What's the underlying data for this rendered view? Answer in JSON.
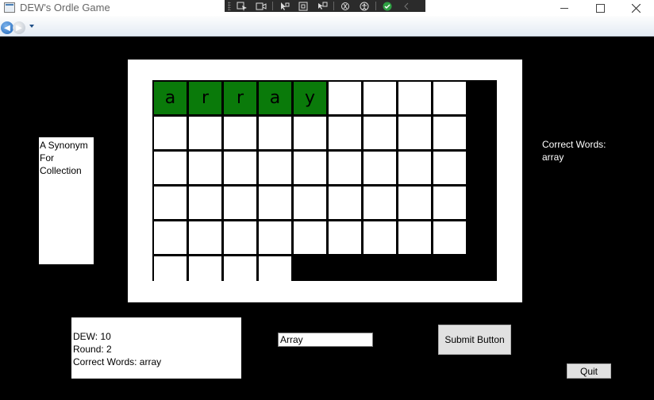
{
  "window": {
    "title": "DEW's Ordle Game",
    "close_color": "#333333"
  },
  "debug_toolbar": {
    "icons": [
      "select-element-icon",
      "video-icon",
      "pointer-icon",
      "display-layout-icon",
      "track-focus-icon",
      "hot-reload-icon",
      "accessibility-icon",
      "check-icon",
      "collapse-icon"
    ]
  },
  "nav": {
    "back_icon": "back-arrow-icon",
    "forward_icon": "forward-arrow-icon"
  },
  "board": {
    "columns": 9,
    "rows": [
      [
        "a",
        "r",
        "r",
        "a",
        "y",
        "",
        "",
        "",
        ""
      ],
      [
        "",
        "",
        "",
        "",
        "",
        "",
        "",
        "",
        ""
      ],
      [
        "",
        "",
        "",
        "",
        "",
        "",
        "",
        "",
        ""
      ],
      [
        "",
        "",
        "",
        "",
        "",
        "",
        "",
        "",
        ""
      ],
      [
        "",
        "",
        "",
        "",
        "",
        "",
        "",
        "",
        ""
      ],
      [
        "",
        "",
        "",
        ""
      ]
    ],
    "green_cells": 5,
    "green_color": "#0a7a0a"
  },
  "hint": {
    "lines": [
      "A Synonym",
      "For",
      "Collection"
    ]
  },
  "correct_panel": {
    "label": "Correct Words:",
    "words": "array"
  },
  "stats": {
    "dew": "DEW: 10",
    "round": "Round: 2",
    "correct": "Correct Words: array"
  },
  "guess": {
    "value": "Array"
  },
  "buttons": {
    "submit": "Submit Button",
    "quit": "Quit"
  }
}
